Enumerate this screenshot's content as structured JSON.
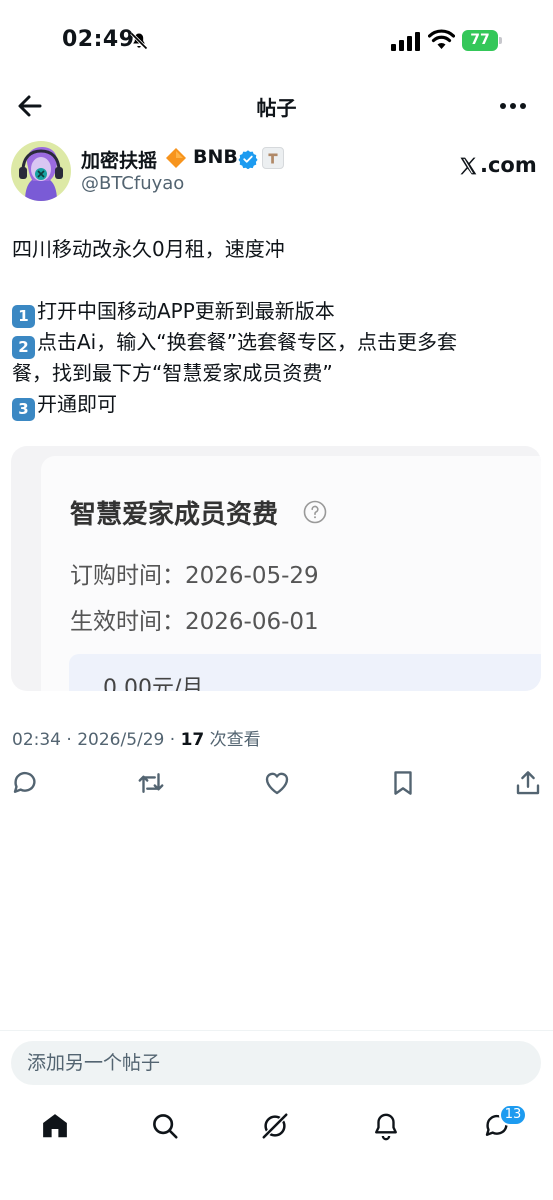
{
  "status_bar": {
    "time": "02:49",
    "battery": "77",
    "icons": [
      "bell-off-icon",
      "cellular-signal-icon",
      "wifi-icon",
      "battery-icon"
    ]
  },
  "header": {
    "title": "帖子",
    "icons": [
      "back-arrow-icon",
      "more-icon"
    ]
  },
  "author": {
    "name": "加密扶摇",
    "name_suffix": "BNB",
    "handle": "@BTCfuyao",
    "source_domain": ".com",
    "icons": [
      "diamond-emoji-icon",
      "verified-icon",
      "affiliate-badge-icon",
      "x-logo-icon"
    ]
  },
  "post": {
    "line1": "四川移动改永久0月租，速度冲",
    "step1_num": "1",
    "step1_text": "打开中国移动APP更新到最新版本",
    "step2_num": "2",
    "step2_text": "点击Ai，输入“换套餐”选套餐专区，点击更多套",
    "step2_cont": "餐，找到最下方“智慧爱家成员资费”",
    "step3_num": "3",
    "step3_text": "开通即可"
  },
  "media": {
    "title": "智慧爱家成员资费",
    "order_time": "订购时间：2026-05-29",
    "effective_time": "生效时间：2026-06-01",
    "price": "0.00元/月"
  },
  "meta": {
    "timestamp": "02:34 · 2026/5/29 · ",
    "views_count": "17",
    "views_label": " 次查看"
  },
  "actions": [
    "reply-icon",
    "repost-icon",
    "like-icon",
    "bookmark-icon",
    "share-icon"
  ],
  "composer": {
    "placeholder": "添加另一个帖子"
  },
  "bottom_nav": {
    "tabs": [
      "home-icon",
      "search-icon",
      "grok-icon",
      "notifications-icon",
      "messages-icon"
    ],
    "messages_badge": "13"
  },
  "colors": {
    "accent": "#1d9bf0",
    "secondary_text": "#536471",
    "battery": "#34c759",
    "keycap": "#3b88c3"
  }
}
